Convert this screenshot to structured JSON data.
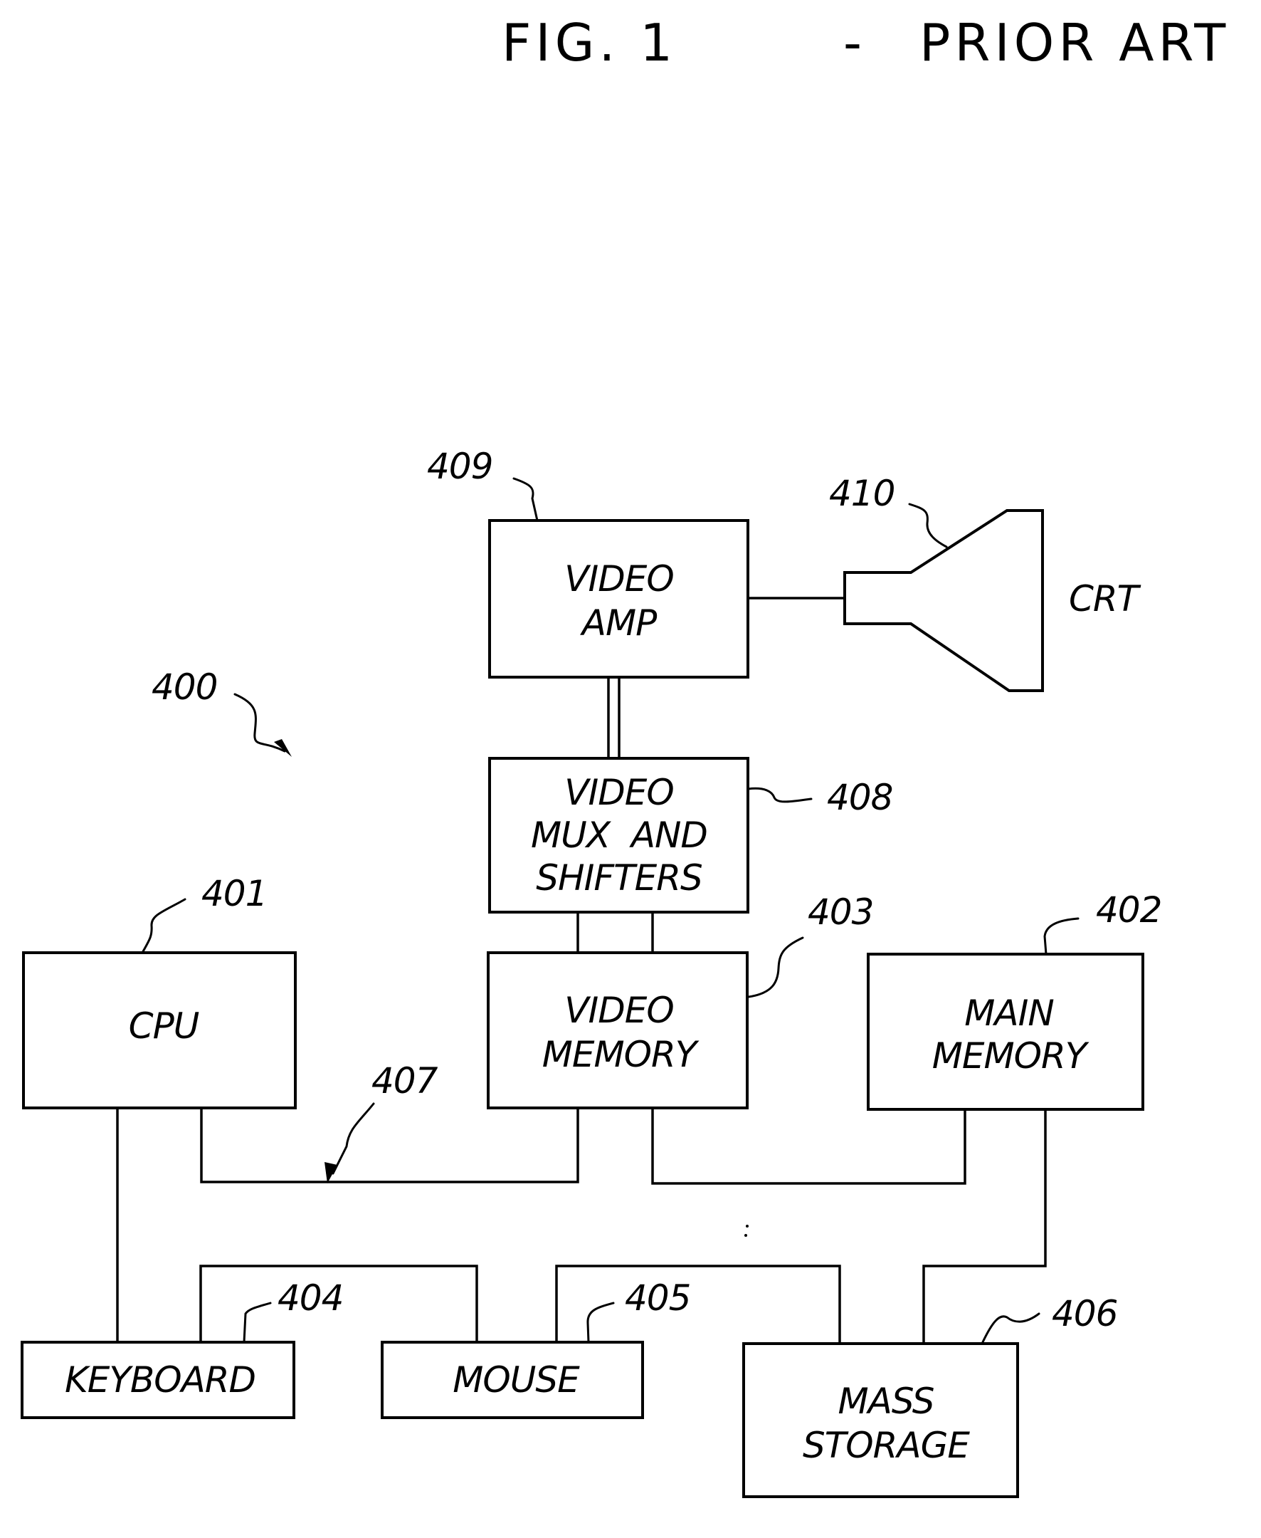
{
  "figure": {
    "title_fig": "FIG. 1",
    "title_dash": "-",
    "title_note": "PRIOR ART",
    "system_ref": "400"
  },
  "blocks": {
    "cpu": {
      "ref": "401",
      "lines": [
        "CPU"
      ]
    },
    "main_memory": {
      "ref": "402",
      "lines": [
        "MAIN",
        "MEMORY"
      ]
    },
    "video_memory": {
      "ref": "403",
      "lines": [
        "VIDEO",
        "MEMORY"
      ]
    },
    "keyboard": {
      "ref": "404",
      "lines": [
        "KEYBOARD"
      ]
    },
    "mouse": {
      "ref": "405",
      "lines": [
        "MOUSE"
      ]
    },
    "mass_storage": {
      "ref": "406",
      "lines": [
        "MASS",
        "STORAGE"
      ]
    },
    "bus": {
      "ref": "407"
    },
    "video_mux": {
      "ref": "408",
      "lines": [
        "VIDEO",
        "MUX  AND",
        "SHIFTERS"
      ]
    },
    "video_amp": {
      "ref": "409",
      "lines": [
        "VIDEO",
        "AMP"
      ]
    },
    "crt": {
      "ref": "410",
      "label": "CRT"
    }
  }
}
